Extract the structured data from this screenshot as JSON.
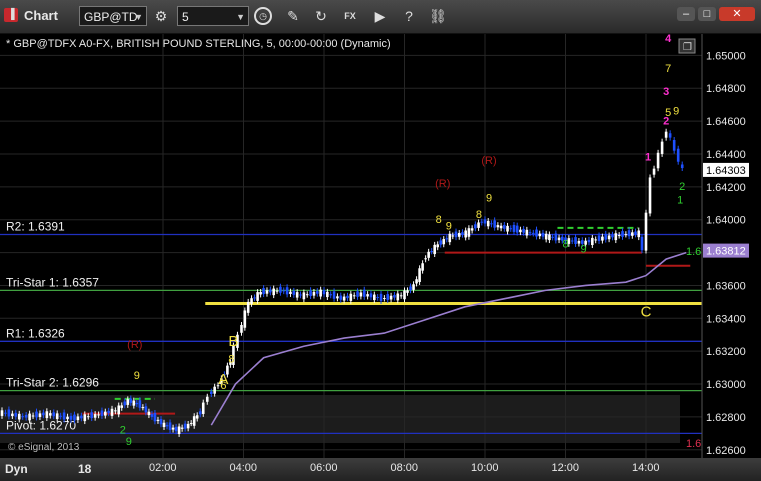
{
  "window": {
    "title": "Chart",
    "symbol": "GBP@TD",
    "interval": "5"
  },
  "chart_header": "* GBP@TDFX A0-FX, BRITISH POUND STERLING, 5, 00:00-00:00 (Dynamic)",
  "copyright": "© eSignal, 2013",
  "status": {
    "mode": "Dyn",
    "date": "18"
  },
  "colors": {
    "bg": "#000000",
    "up_candle": "#ffffff",
    "down_candle": "#1e50ff",
    "vwap": "#9b7fd0",
    "pivot_level": "#2030c0",
    "tristar_level": "#40a040",
    "setup_yellow": "#f0e040",
    "countdown_red": "#b01818",
    "magenta_count": "#ff30d0"
  },
  "chart_data": {
    "type": "candlestick",
    "xlabel": "",
    "ylabel": "",
    "ylim": [
      1.6255,
      1.6513
    ],
    "x_ticks": [
      "02:00",
      "04:00",
      "06:00",
      "08:00",
      "10:00",
      "12:00",
      "14:00"
    ],
    "y_ticks": [
      "1.65000",
      "1.64800",
      "1.64600",
      "1.64400",
      "1.64200",
      "1.64000",
      "1.63800",
      "1.63600",
      "1.63400",
      "1.63200",
      "1.63000",
      "1.62800",
      "1.62600"
    ],
    "last_price": "1.64303",
    "vwap_price": "1.63812",
    "levels": [
      {
        "label": "R2: 1.6391",
        "value": 1.6391,
        "color": "#2030c0"
      },
      {
        "label": "Tri-Star 1: 1.6357",
        "value": 1.6357,
        "color": "#40a040"
      },
      {
        "label": "R1: 1.6326",
        "value": 1.6326,
        "color": "#2030c0"
      },
      {
        "label": "Tri-Star 2: 1.6296",
        "value": 1.6296,
        "color": "#40a040"
      },
      {
        "label": "Pivot: 1.6270",
        "value": 1.627,
        "color": "#2030c0"
      }
    ],
    "letters": [
      {
        "text": "A",
        "time": 3.5,
        "value": 1.63
      },
      {
        "text": "B",
        "time": 3.75,
        "value": 1.6323
      },
      {
        "text": "C",
        "time": 14.0,
        "value": 1.6341
      }
    ],
    "r_markers": [
      {
        "time": 1.3,
        "value": 1.6322
      },
      {
        "time": 8.95,
        "value": 1.642
      },
      {
        "time": 10.1,
        "value": 1.6434
      }
    ],
    "price_tags": [
      {
        "text": "1.6",
        "value": 1.6381
      },
      {
        "text": "1.6",
        "value": 1.6264
      }
    ],
    "magenta_count": [
      {
        "text": "4",
        "time": 14.55,
        "value": 1.6508
      },
      {
        "text": "3",
        "time": 14.5,
        "value": 1.6476
      },
      {
        "text": "2",
        "time": 14.5,
        "value": 1.6458
      },
      {
        "text": "1",
        "time": 14.05,
        "value": 1.6436
      }
    ],
    "yellow_labels": [
      {
        "text": "7",
        "time": 14.55,
        "value": 1.649
      },
      {
        "text": "9",
        "time": 14.75,
        "value": 1.6464
      },
      {
        "text": "5",
        "time": 14.55,
        "value": 1.6463
      },
      {
        "text": "8",
        "time": 8.85,
        "value": 1.6398
      },
      {
        "text": "9",
        "time": 9.1,
        "value": 1.6394
      },
      {
        "text": "9",
        "time": 10.1,
        "value": 1.6411
      },
      {
        "text": "8",
        "time": 9.85,
        "value": 1.6401
      },
      {
        "text": "9",
        "time": 1.35,
        "value": 1.6303
      },
      {
        "text": "8",
        "time": 3.7,
        "value": 1.6313
      },
      {
        "text": "6",
        "time": 3.5,
        "value": 1.6297
      }
    ],
    "green_labels": [
      {
        "text": "2",
        "time": 14.9,
        "value": 1.6418
      },
      {
        "text": "1",
        "time": 14.85,
        "value": 1.641
      },
      {
        "text": "8",
        "time": 12.0,
        "value": 1.6383
      },
      {
        "text": "9",
        "time": 12.45,
        "value": 1.638
      },
      {
        "text": "9",
        "time": 1.15,
        "value": 1.6263
      },
      {
        "text": "2",
        "time": 1.0,
        "value": 1.627
      }
    ],
    "setup_lines": [
      {
        "color": "#f0e040",
        "value": 1.6349,
        "t0": 3.05,
        "t1": 15.4,
        "width": 3
      },
      {
        "color": "#b01818",
        "value": 1.6372,
        "t0": 14.0,
        "t1": 15.1,
        "width": 2
      },
      {
        "color": "#b01818",
        "value": 1.638,
        "t0": 9.0,
        "t1": 13.9,
        "width": 2
      },
      {
        "color": "#b01818",
        "value": 1.6282,
        "t0": 0.0,
        "t1": 2.3,
        "width": 2
      },
      {
        "color": "#30d030",
        "value": 1.6395,
        "t0": 11.8,
        "t1": 13.8,
        "width": 2,
        "dash": "6,4"
      },
      {
        "color": "#30d030",
        "value": 1.6291,
        "t0": 0.8,
        "t1": 1.8,
        "width": 2,
        "dash": "6,4"
      }
    ],
    "series": [
      {
        "name": "price",
        "points": [
          [
            -2.0,
            1.6283
          ],
          [
            -1.4,
            1.628
          ],
          [
            -0.8,
            1.6282
          ],
          [
            -0.2,
            1.6279
          ],
          [
            0.4,
            1.6281
          ],
          [
            0.9,
            1.6284
          ],
          [
            1.2,
            1.629
          ],
          [
            1.5,
            1.6287
          ],
          [
            1.8,
            1.628
          ],
          [
            2.1,
            1.6275
          ],
          [
            2.4,
            1.6272
          ],
          [
            2.7,
            1.6275
          ],
          [
            3.0,
            1.6283
          ],
          [
            3.2,
            1.6293
          ],
          [
            3.45,
            1.63
          ],
          [
            3.75,
            1.6314
          ],
          [
            3.95,
            1.633
          ],
          [
            4.2,
            1.635
          ],
          [
            4.5,
            1.6356
          ],
          [
            5.0,
            1.6357
          ],
          [
            5.5,
            1.6354
          ],
          [
            6.0,
            1.6356
          ],
          [
            6.5,
            1.6352
          ],
          [
            7.0,
            1.6355
          ],
          [
            7.5,
            1.6352
          ],
          [
            8.0,
            1.6354
          ],
          [
            8.3,
            1.636
          ],
          [
            8.6,
            1.6378
          ],
          [
            8.9,
            1.6385
          ],
          [
            9.2,
            1.639
          ],
          [
            9.6,
            1.6392
          ],
          [
            10.0,
            1.6399
          ],
          [
            10.4,
            1.6396
          ],
          [
            10.8,
            1.6394
          ],
          [
            11.2,
            1.6392
          ],
          [
            11.6,
            1.639
          ],
          [
            12.0,
            1.6388
          ],
          [
            12.5,
            1.6386
          ],
          [
            13.0,
            1.6389
          ],
          [
            13.5,
            1.6391
          ],
          [
            13.9,
            1.6392
          ],
          [
            14.0,
            1.638
          ],
          [
            14.1,
            1.6405
          ],
          [
            14.2,
            1.6425
          ],
          [
            14.4,
            1.644
          ],
          [
            14.6,
            1.6455
          ],
          [
            14.8,
            1.6442
          ],
          [
            15.0,
            1.643
          ]
        ]
      },
      {
        "name": "vwap",
        "points": [
          [
            3.2,
            1.6275
          ],
          [
            3.8,
            1.63
          ],
          [
            4.5,
            1.6316
          ],
          [
            5.5,
            1.6323
          ],
          [
            6.5,
            1.6328
          ],
          [
            7.5,
            1.6331
          ],
          [
            8.5,
            1.6339
          ],
          [
            9.5,
            1.6347
          ],
          [
            10.5,
            1.6352
          ],
          [
            11.5,
            1.6357
          ],
          [
            12.5,
            1.636
          ],
          [
            13.5,
            1.6362
          ],
          [
            14.0,
            1.6366
          ],
          [
            14.5,
            1.6376
          ],
          [
            15.0,
            1.638
          ]
        ]
      }
    ]
  }
}
